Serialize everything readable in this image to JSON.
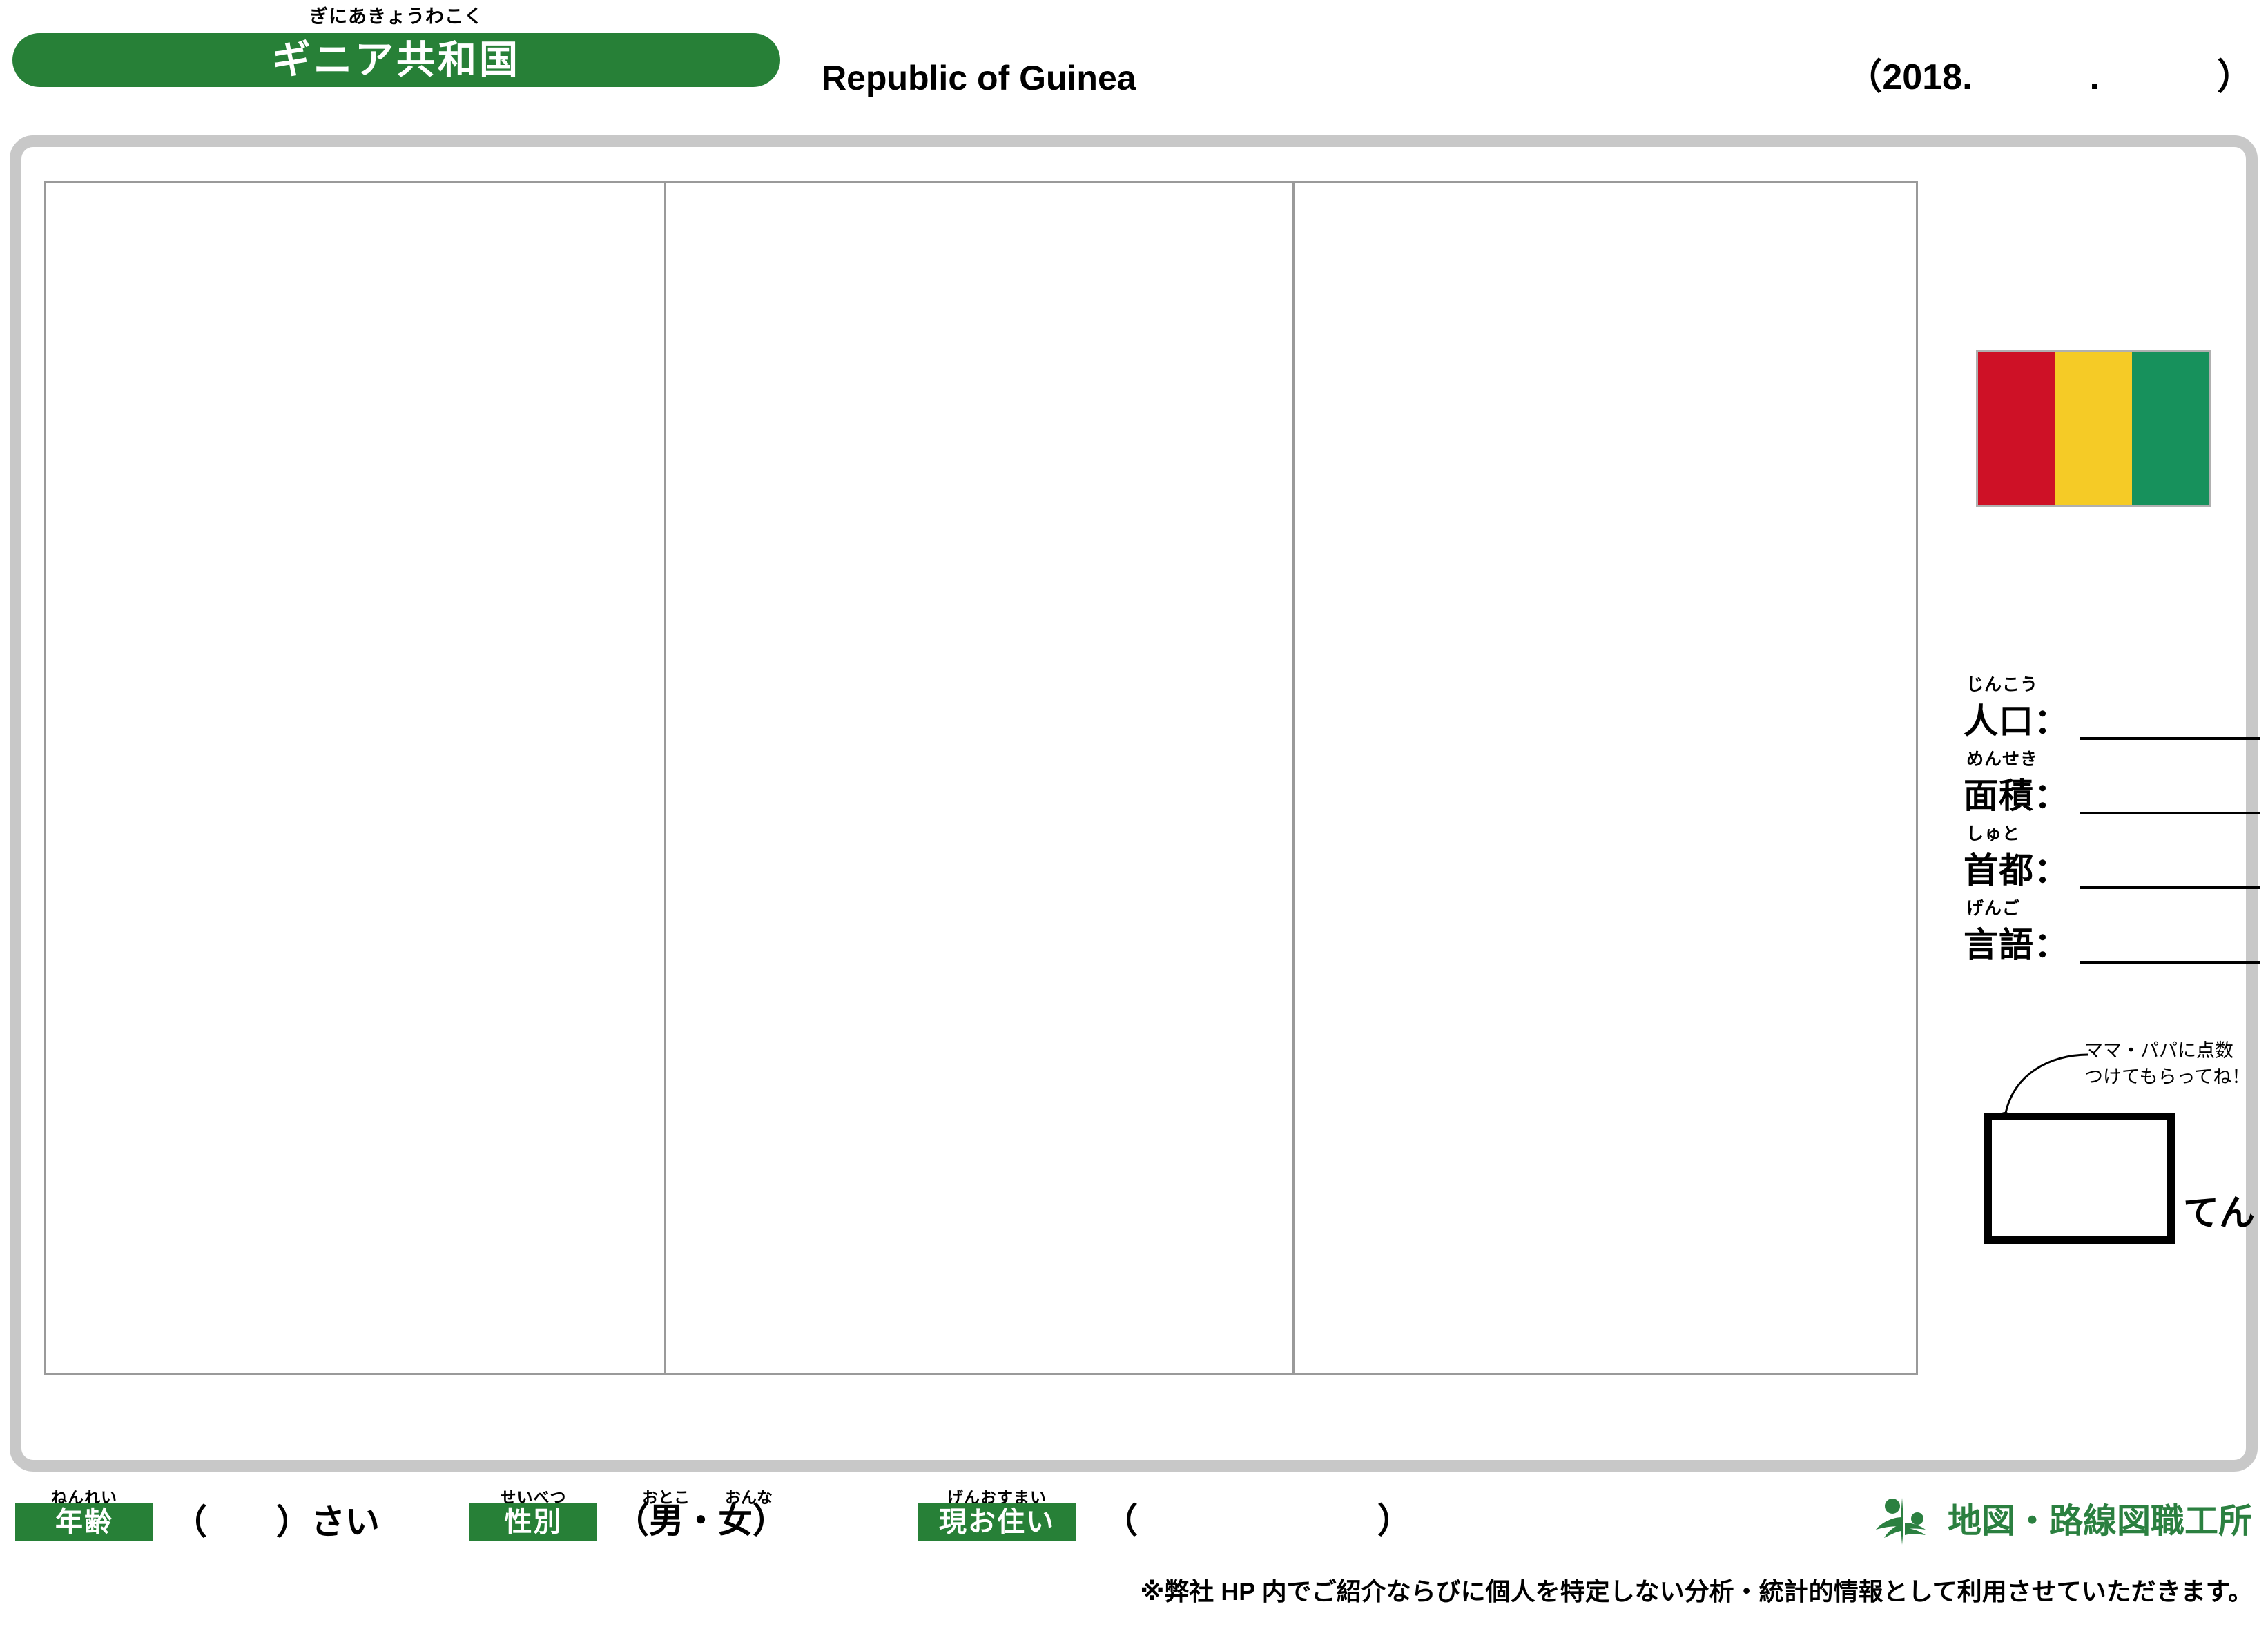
{
  "header": {
    "country_ruby": "ぎにあきょうわこく",
    "country_ja": "ギニア共和国",
    "country_en": "Republic of Guinea",
    "date": {
      "open": "（",
      "year": "2018.",
      "dot": ".",
      "close": "）"
    }
  },
  "sidebar": {
    "flag": {
      "name": "guinea-flag",
      "bands": [
        "#ce1126",
        "#f5cb26",
        "#17915c"
      ]
    },
    "info_fields": [
      {
        "ruby": "じんこう",
        "kanji": "人口",
        "colon": "：",
        "value": ""
      },
      {
        "ruby": "めんせき",
        "kanji": "面積",
        "colon": "：",
        "value": ""
      },
      {
        "ruby": "しゅと",
        "kanji": "首都",
        "colon": "：",
        "value": ""
      },
      {
        "ruby": "げんご",
        "kanji": "言語",
        "colon": "：",
        "value": ""
      }
    ],
    "score": {
      "note_line1": "ママ・パパに点数",
      "note_line2": "つけてもらってね！",
      "value": "",
      "unit": "てん"
    }
  },
  "form": {
    "age": {
      "ruby": "ねんれい",
      "label": "年齢",
      "value": "（　　）さい"
    },
    "sex": {
      "ruby": "せいべつ",
      "label": "性別",
      "value": "（男・女）",
      "ruby_male": "おとこ",
      "ruby_female": "おんな"
    },
    "address": {
      "ruby": "げんおすまい",
      "label": "現お住い",
      "open": "（",
      "close": "）",
      "value": ""
    }
  },
  "footer": {
    "logo_text": "地図・路線図職工所",
    "disclaimer": "※弊社 HP 内でご紹介ならびに個人を特定しない分析・統計的情報として利用させていただきます。"
  },
  "colors": {
    "brand_green": "#278037",
    "logo_green": "#2b8040",
    "frame_gray": "#c8c8c8",
    "panel_line": "#9a9a9a"
  }
}
